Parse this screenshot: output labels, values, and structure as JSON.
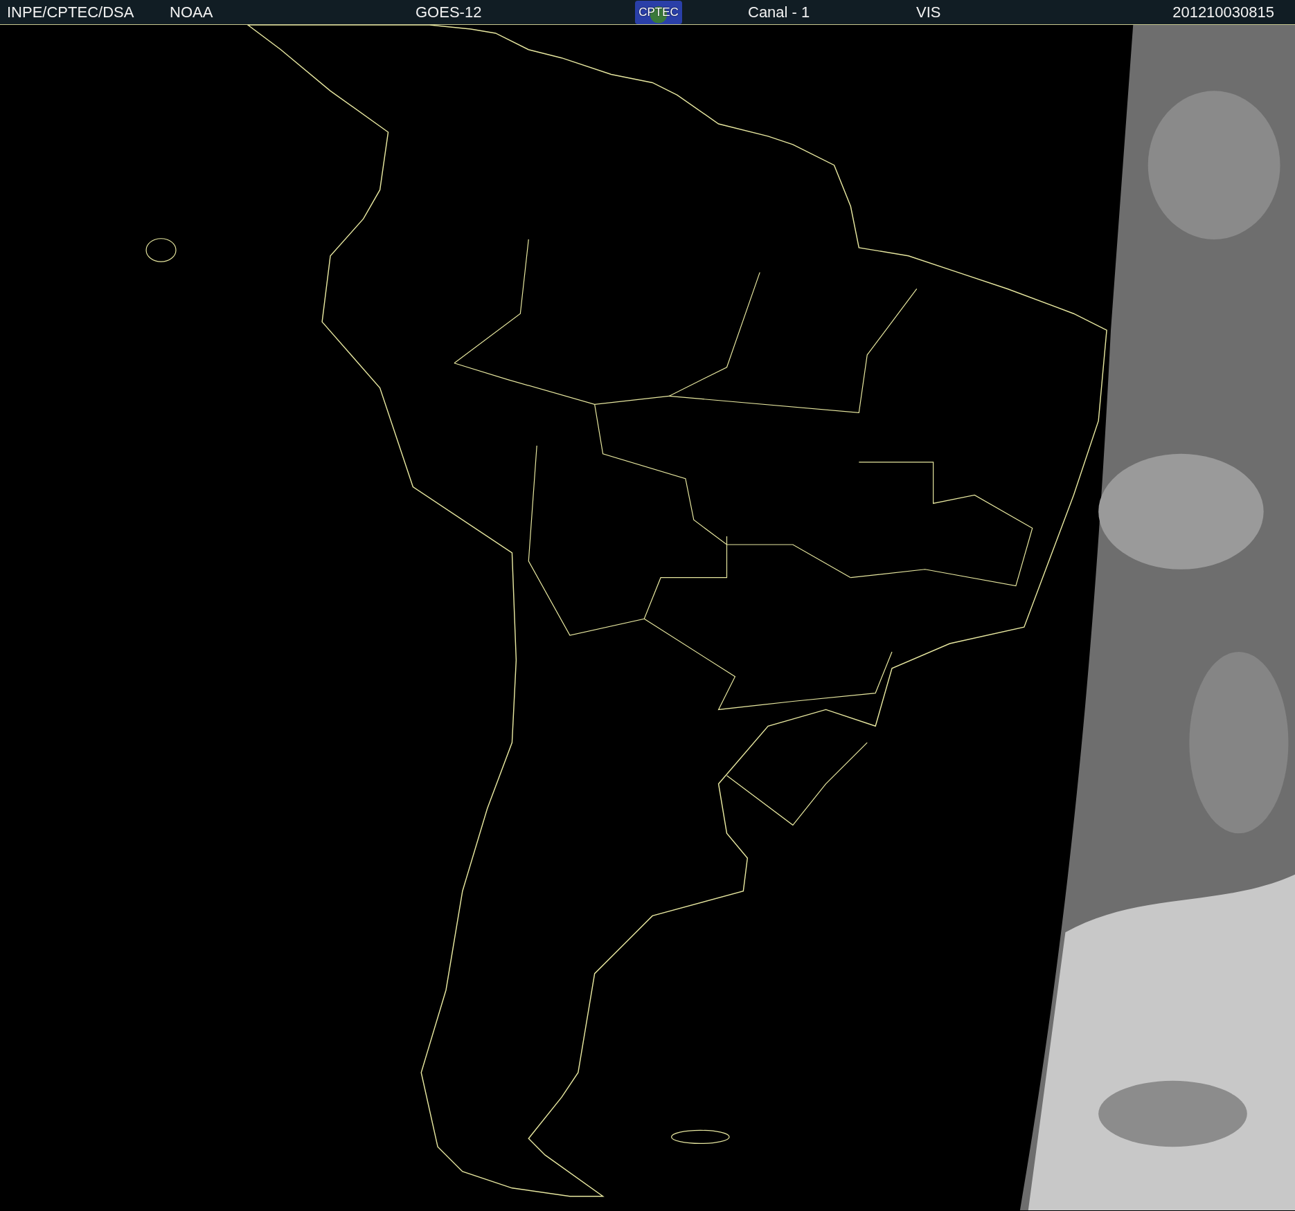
{
  "header": {
    "source": "INPE/CPTEC/DSA",
    "agency": "NOAA",
    "satellite": "GOES-12",
    "logo": {
      "text": "CPTEC"
    },
    "channel": "Canal - 1",
    "band": "VIS",
    "timestamp": "201210030815"
  }
}
